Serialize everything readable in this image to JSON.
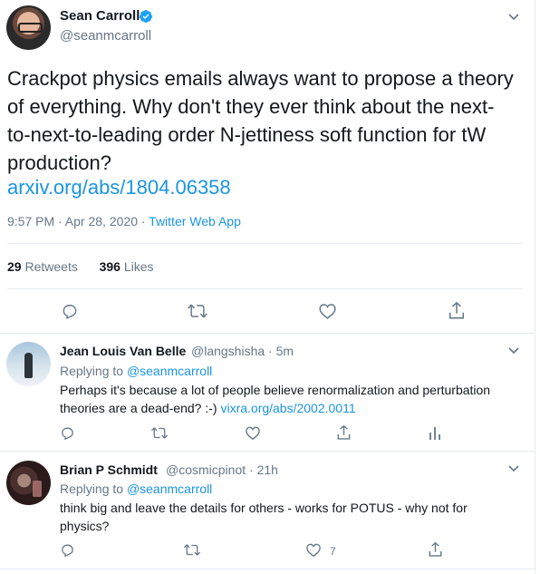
{
  "main_tweet": {
    "author_name": "Sean Carroll",
    "handle": "@seanmcarroll",
    "text": "Crackpot physics emails always want to propose a theory of everything. Why don't they ever think about the next-to-next-to-leading order N-jettiness soft function for tW production?",
    "link": "arxiv.org/abs/1804.06358",
    "timestamp": "9:57 PM · Apr 28, 2020 · ",
    "app": "Twitter Web App",
    "retweets_count": "29",
    "retweets_label": "Retweets",
    "likes_count": "396",
    "likes_label": "Likes"
  },
  "replies": [
    {
      "author_name": "Jean Louis Van Belle",
      "handle": "@langshisha · 5m",
      "replying_prefix": "Replying to ",
      "replying_to": "@seanmcarroll",
      "text_line1": "Perhaps it's because a lot of people believe renormalization and perturbation",
      "text_line2": "theories are a dead-end? :-) ",
      "link": "vixra.org/abs/2002.0011"
    },
    {
      "author_name": "Brian P Schmidt",
      "handle": "@cosmicpinot · 21h",
      "replying_prefix": "Replying to ",
      "replying_to": "@seanmcarroll",
      "text_line1": "think big and leave the details for others - works for POTUS - why not for",
      "text_line2": "physics?",
      "like_count": "7"
    }
  ],
  "icons": [
    "verified-badge-icon",
    "chevron-down-icon",
    "reply-icon",
    "retweet-icon",
    "like-icon",
    "share-icon",
    "analytics-icon"
  ],
  "colors": {
    "link": "#1b95e0",
    "muted": "#657786",
    "text": "#14171a",
    "divider": "#e6ecf0"
  }
}
